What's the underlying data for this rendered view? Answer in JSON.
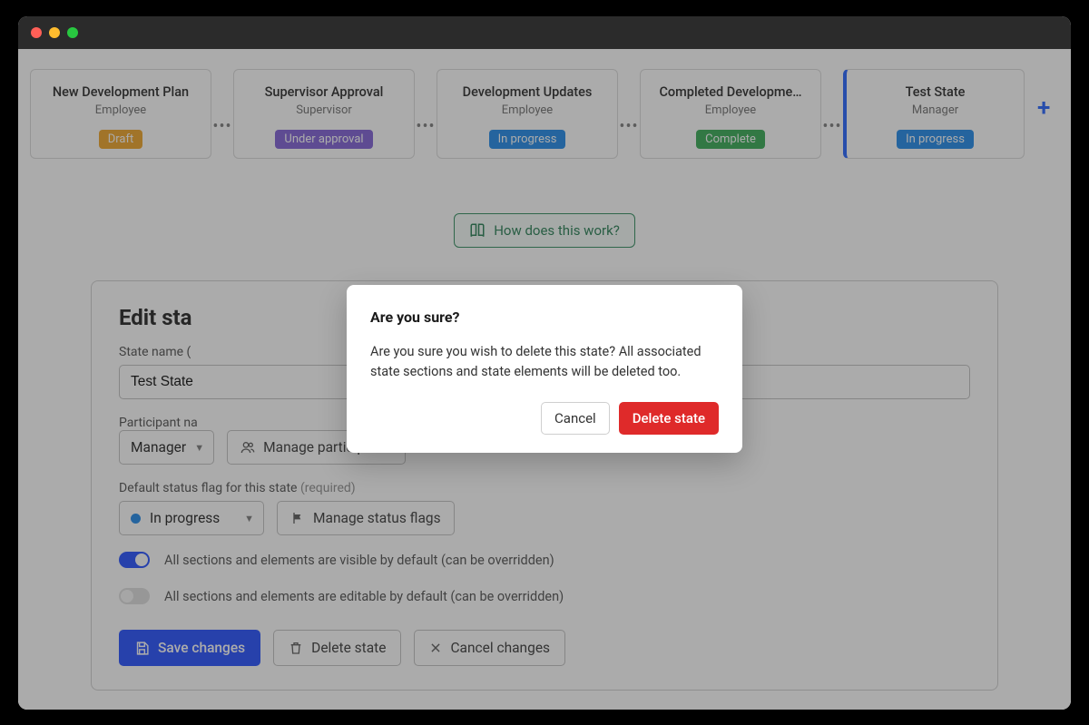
{
  "states": [
    {
      "name": "New Development Plan",
      "role": "Employee",
      "badge": "Draft",
      "badgeClass": "draft"
    },
    {
      "name": "Supervisor Approval",
      "role": "Supervisor",
      "badge": "Under approval",
      "badgeClass": "approval"
    },
    {
      "name": "Development Updates",
      "role": "Employee",
      "badge": "In progress",
      "badgeClass": "progress"
    },
    {
      "name": "Completed Developme…",
      "role": "Employee",
      "badge": "Complete",
      "badgeClass": "complete"
    },
    {
      "name": "Test State",
      "role": "Manager",
      "badge": "In progress",
      "badgeClass": "progress",
      "active": true
    }
  ],
  "help_label": "How does this work?",
  "edit": {
    "title": "Edit sta",
    "name_label": "State name (",
    "name_value": "Test State",
    "participant_label": "Participant na",
    "participant_value": "Manager",
    "manage_participants": "Manage participants",
    "flag_label": "Default status flag for this state",
    "flag_required": "(required)",
    "flag_value": "In progress",
    "manage_flags": "Manage status flags",
    "toggle_visible": "All sections and elements are visible by default (can be overridden)",
    "toggle_editable": "All sections and elements are editable by default (can be overridden)",
    "save": "Save changes",
    "delete": "Delete state",
    "cancel": "Cancel changes"
  },
  "modal": {
    "title": "Are you sure?",
    "body": "Are you sure you wish to delete this state? All associated state sections and state elements will be deleted too.",
    "cancel": "Cancel",
    "confirm": "Delete state"
  }
}
